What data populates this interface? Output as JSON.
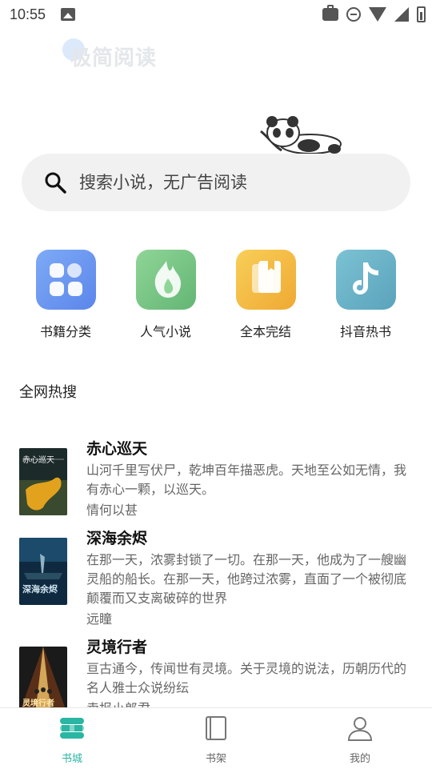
{
  "status_bar": {
    "time": "10:55"
  },
  "banner": {
    "logo_text": "极简阅读"
  },
  "search": {
    "placeholder": "搜索小说，无广告阅读"
  },
  "categories": [
    {
      "label": "书籍分类",
      "icon": "grid-icon",
      "color": "#6f9af0"
    },
    {
      "label": "人气小说",
      "icon": "flame-icon",
      "color": "#7cc687"
    },
    {
      "label": "全本完结",
      "icon": "book-stack-icon",
      "color": "#f3bb44"
    },
    {
      "label": "抖音热书",
      "icon": "tiktok-icon",
      "color": "#6fb4c8"
    }
  ],
  "section_title": "全网热搜",
  "books": [
    {
      "title": "赤心巡天",
      "desc": "山河千里写伏尸，乾坤百年描恶虎。天地至公如无情，我有赤心一颗，以巡天。",
      "author": "情何以甚"
    },
    {
      "title": "深海余烬",
      "desc": "在那一天，浓雾封锁了一切。在那一天，他成为了一艘幽灵船的船长。在那一天，他跨过浓雾，直面了一个被彻底颠覆而又支离破碎的世界",
      "author": "远瞳"
    },
    {
      "title": "灵境行者",
      "desc": "亘古通今，传闻世有灵境。关于灵境的说法，历朝历代的名人雅士众说纷纭",
      "author": "卖报小郎君"
    }
  ],
  "bottom_nav": [
    {
      "label": "书城",
      "active": true
    },
    {
      "label": "书架",
      "active": false
    },
    {
      "label": "我的",
      "active": false
    }
  ],
  "colors": {
    "accent": "#2bb5a3",
    "search_bg": "#f1f1f1"
  }
}
